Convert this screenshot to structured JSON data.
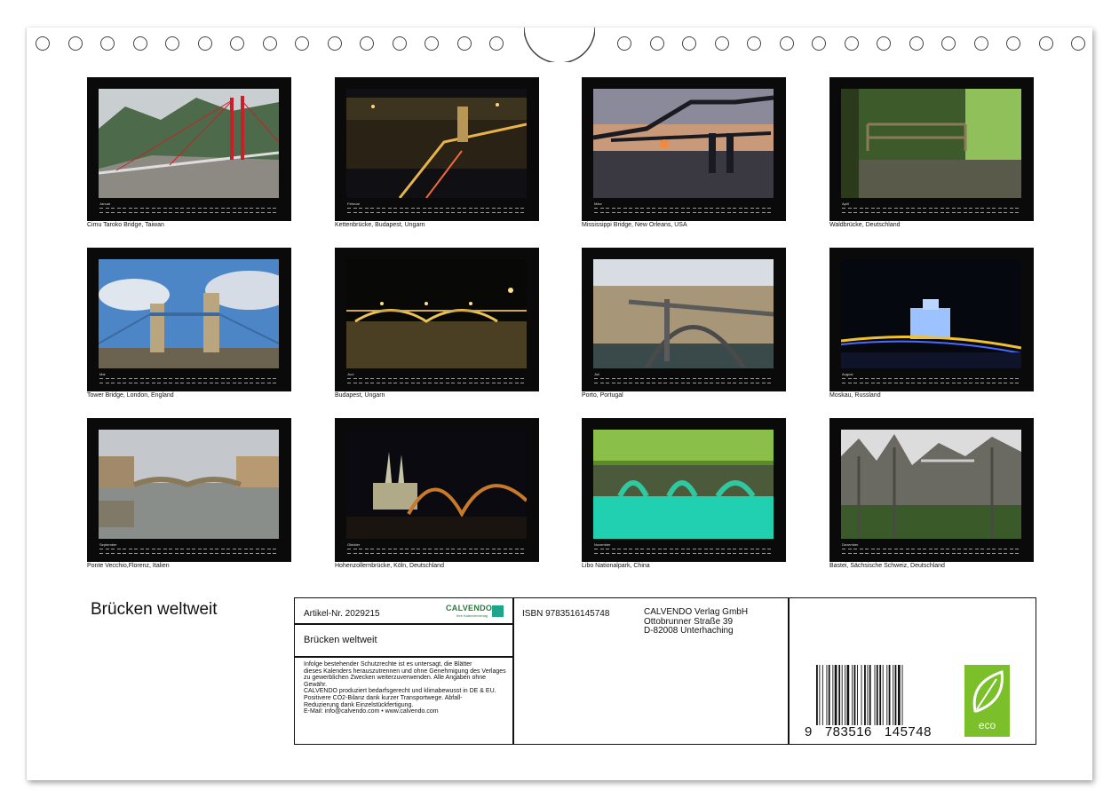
{
  "calendar": {
    "title": "Brücken weltweit",
    "year": "2026",
    "months": [
      {
        "month": "Januar",
        "caption": "Cimu Taroko Bridge, Taiwan"
      },
      {
        "month": "Februar",
        "caption": "Kettenbrücke, Budapest, Ungarn"
      },
      {
        "month": "März",
        "caption": "Mississippi Bridge, New Orleans, USA"
      },
      {
        "month": "April",
        "caption": "Waldbrücke, Deutschland"
      },
      {
        "month": "Mai",
        "caption": "Tower Bridge, London, England"
      },
      {
        "month": "Juni",
        "caption": "Budapest, Ungarn"
      },
      {
        "month": "Juli",
        "caption": "Porto, Portugal"
      },
      {
        "month": "August",
        "caption": "Moskau, Russland"
      },
      {
        "month": "September",
        "caption": "Ponte Vecchio,Florenz, Italien"
      },
      {
        "month": "Oktober",
        "caption": "Hohenzollernbrücke, Köln, Deutschland"
      },
      {
        "month": "November",
        "caption": "Libo Nationalpark, China"
      },
      {
        "month": "Dezember",
        "caption": "Bastei, Sächsische Schweiz, Deutschland"
      }
    ]
  },
  "info": {
    "article": "Artikel-Nr. 2029215",
    "logo_text": "CALVENDO",
    "logo_sub": "Ihre Kalenderverlag",
    "book_title": "Brücken weltweit",
    "fine_print": [
      "Infolge bestehender Schutzrechte ist es untersagt, die Blätter",
      "dieses Kalenders herauszutrennen und ohne Genehmigung des Verlages",
      "zu gewerblichen Zwecken weiterzuverwenden. Alle Angaben ohne",
      "Gewähr.",
      "CALVENDO produziert bedarfsgerecht und klimabewusst in DE & EU.",
      "Positivere CO2-Bilanz dank kurzer Transportwege. Abfall-",
      "Reduzierung dank Einzelstückfertigung.",
      "E-Mail: info@calvendo.com • www.calvendo.com"
    ],
    "isbn": "ISBN 9783516145748",
    "publisher": [
      "CALVENDO Verlag GmbH",
      "Ottobrunner Straße 39",
      "D-82008 Unterhaching"
    ],
    "barcode_number": "9   783516   145748",
    "eco_label": "eco"
  }
}
